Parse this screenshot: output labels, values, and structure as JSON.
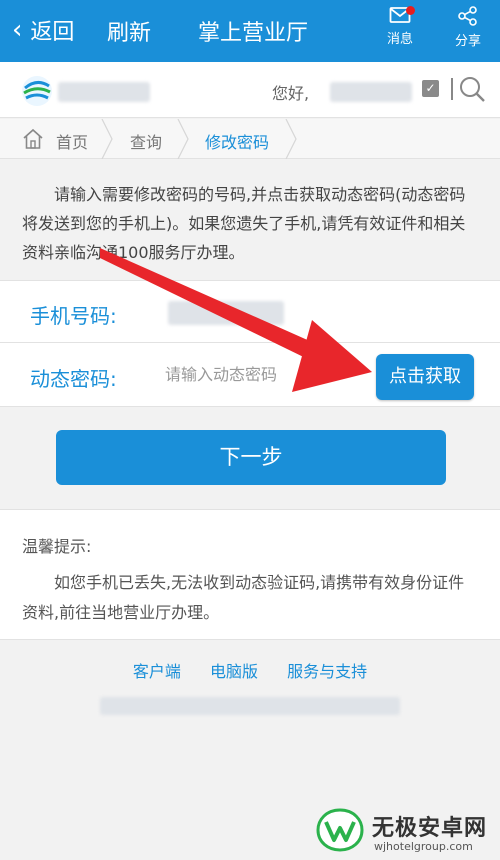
{
  "topbar": {
    "back_label": "返回",
    "refresh_label": "刷新",
    "title": "掌上营业厅",
    "message_label": "消息",
    "share_label": "分享"
  },
  "header": {
    "greeting": "您好,"
  },
  "breadcrumb": {
    "home": "首页",
    "query": "查询",
    "current": "修改密码"
  },
  "intro": {
    "text": "请输入需要修改密码的号码,并点击获取动态密码(动态密码将发送到您的手机上)。如果您遗失了手机,请凭有效证件和相关资料亲临沟通100服务厅办理。"
  },
  "form": {
    "phone_label": "手机号码:",
    "code_label": "动态密码:",
    "code_placeholder": "请输入动态密码",
    "get_code_label": "点击获取",
    "next_label": "下一步"
  },
  "tips": {
    "title": "温馨提示:",
    "body": "如您手机已丢失,无法收到动态验证码,请携带有效身份证件资料,前往当地营业厅办理。"
  },
  "footer": {
    "links": [
      "客户端",
      "电脑版",
      "服务与支持"
    ]
  },
  "watermark": {
    "name": "无极安卓网",
    "url": "wjhotelgroup.com"
  },
  "colors": {
    "primary": "#1a8fd8",
    "arrow": "#e8262b"
  }
}
